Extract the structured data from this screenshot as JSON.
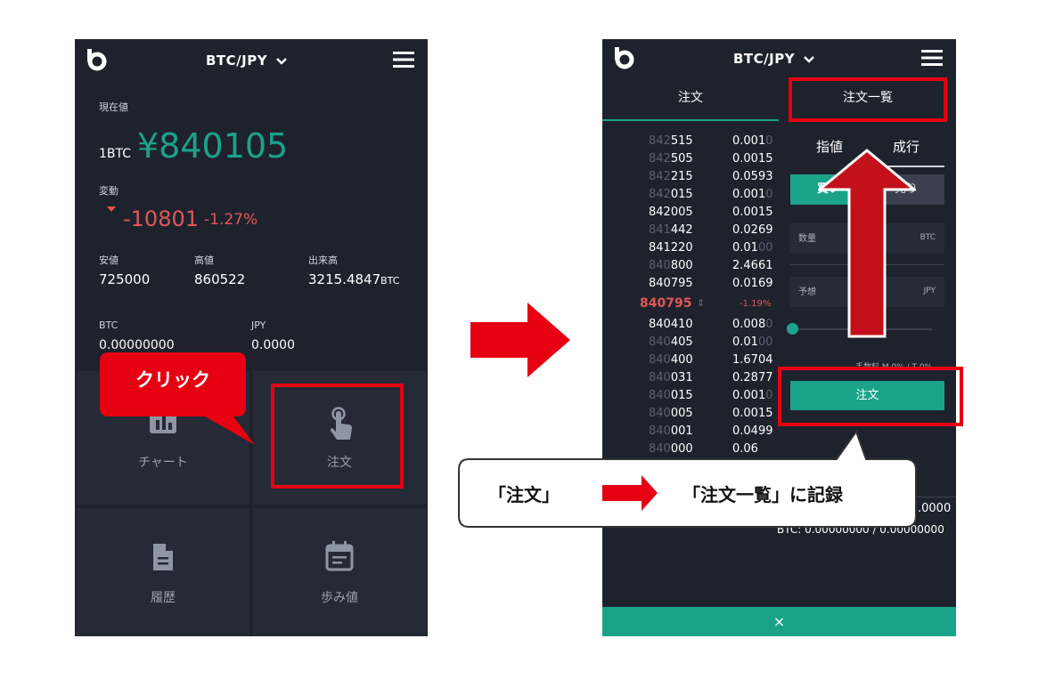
{
  "left": {
    "pair": "BTC/JPY",
    "current_label": "現在値",
    "unit": "1BTC",
    "price": "¥840105",
    "change_label": "変動",
    "change_value": "-10801",
    "change_pct": "-1.27%",
    "stats": [
      {
        "label": "安値",
        "value": "725000",
        "suffix": ""
      },
      {
        "label": "高値",
        "value": "860522",
        "suffix": ""
      },
      {
        "label": "出来高",
        "value": "3215.4847",
        "suffix": "BTC"
      }
    ],
    "balances": [
      {
        "label": "BTC",
        "value": "0.00000000"
      },
      {
        "label": "JPY",
        "value": "0.0000"
      }
    ],
    "tiles": [
      "チャート",
      "注文",
      "履歴",
      "歩み値"
    ],
    "callout": "クリック"
  },
  "right": {
    "pair": "BTC/JPY",
    "tabs": [
      "注文",
      "注文一覧"
    ],
    "sell_rows": [
      {
        "dim": "842",
        "bright": "515",
        "qty": "0.0010",
        "qty_dim": "0"
      },
      {
        "dim": "842",
        "bright": "505",
        "qty": "0.0015",
        "qty_dim": ""
      },
      {
        "dim": "842",
        "bright": "215",
        "qty": "0.0593",
        "qty_dim": ""
      },
      {
        "dim": "842",
        "bright": "015",
        "qty": "0.0010",
        "qty_dim": "0"
      },
      {
        "dim": "",
        "bright": "842005",
        "qty": "0.0015",
        "qty_dim": ""
      },
      {
        "dim": "841",
        "bright": "442",
        "qty": "0.0269",
        "qty_dim": ""
      },
      {
        "dim": "",
        "bright": "841220",
        "qty": "0.0100",
        "qty_dim": "00"
      },
      {
        "dim": "840",
        "bright": "800",
        "qty": "2.4661",
        "qty_dim": ""
      },
      {
        "dim": "",
        "bright": "840795",
        "qty": "0.0169",
        "qty_dim": ""
      }
    ],
    "mid_price": "840795",
    "mid_change": "-1.19%",
    "buy_rows": [
      {
        "dim": "",
        "bright": "840410",
        "qty": "0.0080",
        "qty_dim": "0"
      },
      {
        "dim": "840",
        "bright": "405",
        "qty": "0.0100",
        "qty_dim": "00"
      },
      {
        "dim": "840",
        "bright": "400",
        "qty": "1.6704",
        "qty_dim": ""
      },
      {
        "dim": "840",
        "bright": "031",
        "qty": "0.2877",
        "qty_dim": ""
      },
      {
        "dim": "840",
        "bright": "015",
        "qty": "0.0010",
        "qty_dim": "0"
      },
      {
        "dim": "840",
        "bright": "005",
        "qty": "0.0015",
        "qty_dim": ""
      },
      {
        "dim": "840",
        "bright": "001",
        "qty": "0.0499",
        "qty_dim": ""
      },
      {
        "dim": "840",
        "bright": "000",
        "qty": "0.06",
        "qty_dim": ""
      }
    ],
    "order_types": [
      "指値",
      "成行"
    ],
    "buy_label": "買い",
    "sell_label": "売り",
    "qty_label": "数量",
    "qty_unit": "BTC",
    "est_label": "予想",
    "est_unit": "JPY",
    "fee_text": "手数料 M 0% / T 0%",
    "order_button": "注文",
    "balance_line1": ".0000",
    "balance_line2": "BTC: 0.00000000 / 0.00000000",
    "close": "×"
  },
  "bubble": {
    "from": "「注文」",
    "to": "「注文一覧」に記録"
  },
  "colors": {
    "bg": "#1e222d",
    "accent": "#1ba38a",
    "down": "#e05757",
    "highlight": "#e60012"
  }
}
